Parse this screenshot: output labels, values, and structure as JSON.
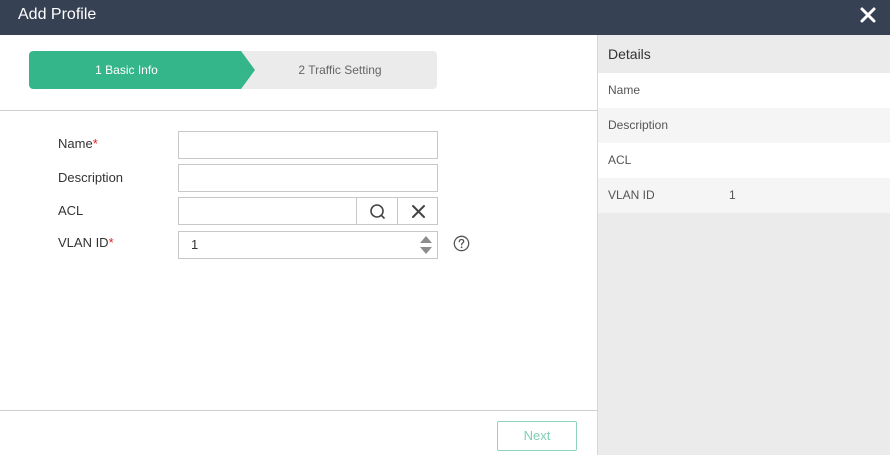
{
  "window": {
    "title": "Add Profile",
    "close_icon": "close-icon"
  },
  "steps": [
    {
      "label": "1 Basic Info",
      "active": true
    },
    {
      "label": "2 Traffic Setting",
      "active": false
    }
  ],
  "form": {
    "name": {
      "label": "Name",
      "required_mark": "*",
      "value": ""
    },
    "description": {
      "label": "Description",
      "value": ""
    },
    "acl": {
      "label": "ACL",
      "value": "",
      "search_icon": "search-icon",
      "clear_icon": "clear-icon"
    },
    "vlan_id": {
      "label": "VLAN ID",
      "required_mark": "*",
      "value": "1",
      "help_icon": "help-icon"
    }
  },
  "footer": {
    "next_label": "Next"
  },
  "details": {
    "title": "Details",
    "rows": [
      {
        "key": "Name",
        "value": ""
      },
      {
        "key": "Description",
        "value": ""
      },
      {
        "key": "ACL",
        "value": ""
      },
      {
        "key": "VLAN ID",
        "value": "1"
      }
    ]
  },
  "colors": {
    "titlebar": "#364153",
    "accent": "#34b58a",
    "required": "#e02020"
  }
}
